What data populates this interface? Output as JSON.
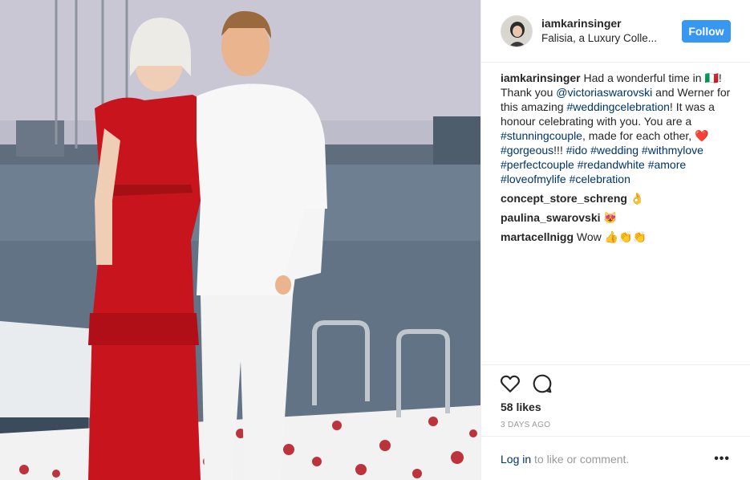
{
  "post": {
    "author": "iamkarinsinger",
    "location": "Falisia, a Luxury Colle...",
    "follow_label": "Follow",
    "caption": {
      "username": "iamkarinsinger",
      "parts": [
        {
          "t": "Had a wonderful time in 🇮🇹! Thank you ",
          "type": "text"
        },
        {
          "t": "@victoriaswarovski",
          "type": "tag"
        },
        {
          "t": " and Werner for this amazing ",
          "type": "text"
        },
        {
          "t": "#weddingcelebration",
          "type": "tag"
        },
        {
          "t": "! It was a honour celebrating with you. You are a ",
          "type": "text"
        },
        {
          "t": "#stunningcouple",
          "type": "tag"
        },
        {
          "t": ", made for each other, ❤️ ",
          "type": "text"
        },
        {
          "t": "#gorgeous",
          "type": "tag"
        },
        {
          "t": "!!! ",
          "type": "text"
        },
        {
          "t": "#ido",
          "type": "tag"
        },
        {
          "t": " ",
          "type": "text"
        },
        {
          "t": "#wedding",
          "type": "tag"
        },
        {
          "t": " ",
          "type": "text"
        },
        {
          "t": "#withmylove",
          "type": "tag"
        },
        {
          "t": " ",
          "type": "text"
        },
        {
          "t": "#perfectcouple",
          "type": "tag"
        },
        {
          "t": " ",
          "type": "text"
        },
        {
          "t": "#redandwhite",
          "type": "tag"
        },
        {
          "t": " ",
          "type": "text"
        },
        {
          "t": "#amore",
          "type": "tag"
        },
        {
          "t": " ",
          "type": "text"
        },
        {
          "t": "#loveofmylife",
          "type": "tag"
        },
        {
          "t": " ",
          "type": "text"
        },
        {
          "t": "#celebration",
          "type": "tag"
        }
      ]
    },
    "comments": [
      {
        "username": "concept_store_schreng",
        "text": "👌"
      },
      {
        "username": "paulina_swarovski",
        "text": "😻"
      },
      {
        "username": "martacellnigg",
        "text": "Wow 👍👏👏"
      }
    ],
    "likes": "58 likes",
    "date": "3 DAYS AGO",
    "footer": {
      "login_link": "Log in",
      "login_rest": " to like or comment.",
      "more": "•••"
    },
    "icons": {
      "like": "heart-icon",
      "comment": "comment-bubble-icon",
      "more": "ellipsis-icon"
    }
  }
}
